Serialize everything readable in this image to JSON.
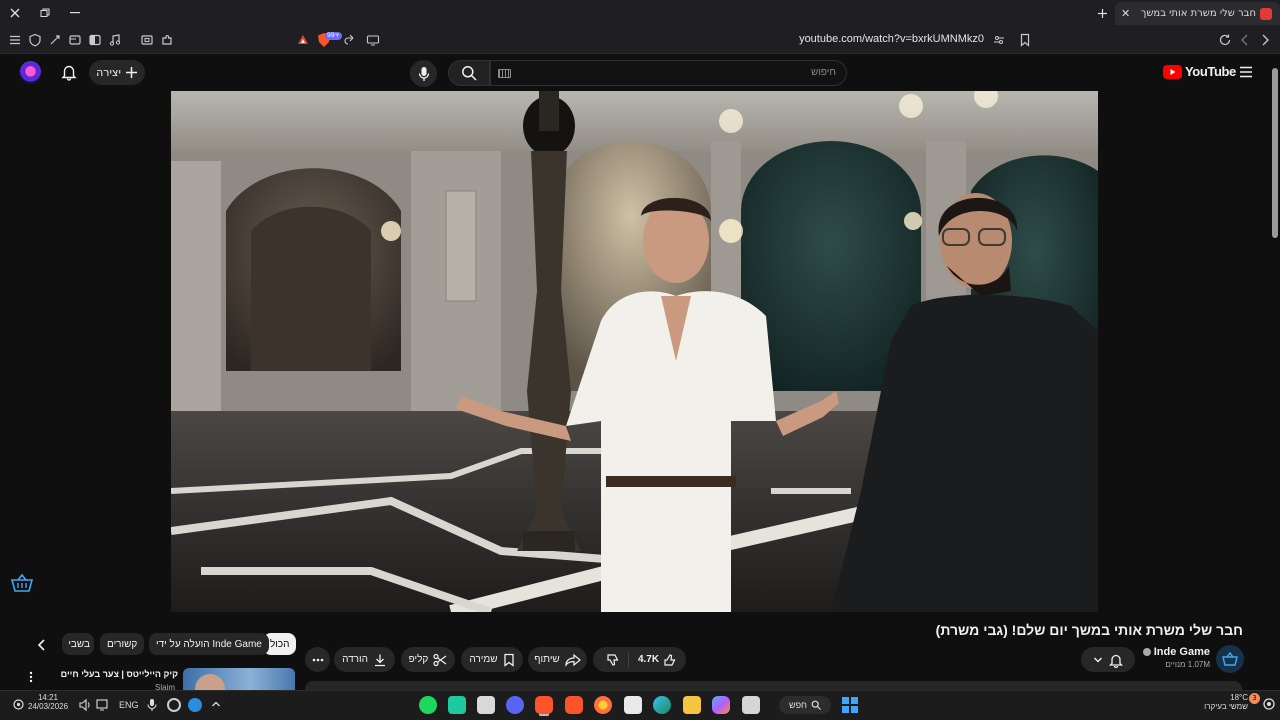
{
  "browser": {
    "tab_title": "חבר שלי משרת אותי במשך",
    "url": "youtube.com/watch?v=bxrkUMNMkz0",
    "brave_badge": "99+"
  },
  "youtube": {
    "logo_text": "YouTube",
    "search_placeholder": "חיפוש",
    "create_label": "יצירה"
  },
  "video": {
    "title": "חבר שלי משרת אותי במשך יום שלם! (גבי משרת)",
    "channel_name": "Inde Game",
    "subscribers": "1.07M מנויים",
    "likes": "4.7K",
    "share_label": "שיתוף",
    "save_label": "שמירה",
    "clip_label": "קליפ",
    "download_label": "הורדה"
  },
  "chips": [
    {
      "label": "הכול",
      "active": true
    },
    {
      "label": "הועלה על ידי Inde Game",
      "active": false
    },
    {
      "label": "קשורים",
      "active": false
    },
    {
      "label": "בשבי",
      "active": false
    }
  ],
  "recommendation": {
    "title": "קיק היילייטס | צער בעלי חיים",
    "channel": "Slaim"
  },
  "taskbar": {
    "time": "14:21",
    "date": "24/03/2026",
    "lang": "ENG",
    "search_label": "חפש",
    "weather_temp": "18°C",
    "weather_desc": "שמשי בעיקרו",
    "notif_count": "3"
  }
}
